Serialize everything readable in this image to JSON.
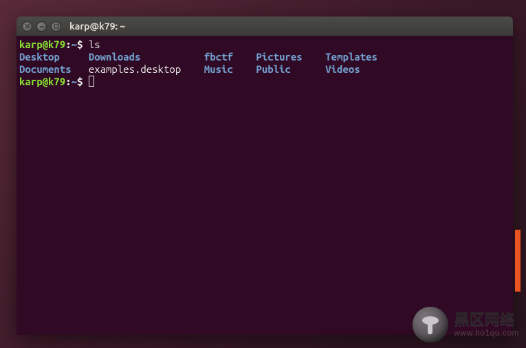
{
  "window": {
    "title": "karp@k79: ~"
  },
  "prompt": {
    "user_host": "karp@k79",
    "sep1": ":",
    "path": "~",
    "sep2": "$"
  },
  "command": "ls",
  "ls_items": [
    {
      "name": "Desktop",
      "type": "dir"
    },
    {
      "name": "Downloads",
      "type": "dir"
    },
    {
      "name": "fbctf",
      "type": "dir"
    },
    {
      "name": "Pictures",
      "type": "dir"
    },
    {
      "name": "Templates",
      "type": "dir"
    },
    {
      "name": "Documents",
      "type": "dir"
    },
    {
      "name": "examples.desktop",
      "type": "file"
    },
    {
      "name": "Music",
      "type": "dir"
    },
    {
      "name": "Public",
      "type": "dir"
    },
    {
      "name": "Videos",
      "type": "dir"
    }
  ],
  "ls_columns": [
    10,
    18,
    7,
    10,
    0
  ],
  "watermark": {
    "main": "黑区网络",
    "sub": "www.ho1qu.com"
  }
}
